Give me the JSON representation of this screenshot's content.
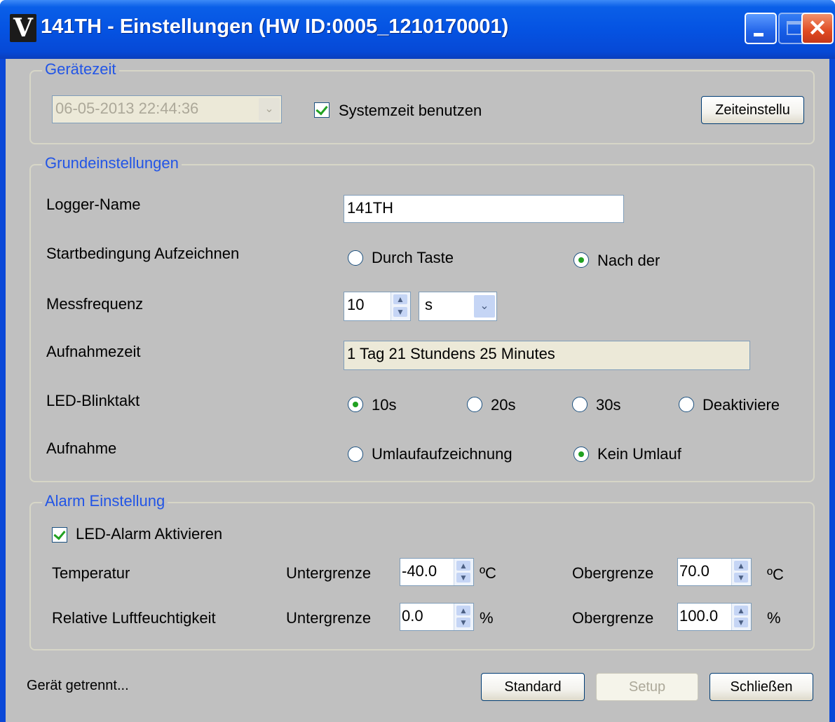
{
  "window": {
    "title": "141TH - Einstellungen (HW ID:0005_1210170001)",
    "icon_letter": "V",
    "close_glyph": "✕"
  },
  "geraetezeit": {
    "legend": "Gerätezeit",
    "datetime_value": "06-05-2013 22:44:36",
    "systemzeit_label": "Systemzeit benutzen",
    "systemzeit_checked": true,
    "zeiteinstellung_button": "Zeiteinstellu"
  },
  "grundeinstellungen": {
    "legend": "Grundeinstellungen",
    "logger_name_label": "Logger-Name",
    "logger_name_value": "141TH",
    "startbedingung_label": "Startbedingung Aufzeichnen",
    "start_options": [
      "Durch Taste",
      "Nach der"
    ],
    "start_selected": "Nach der",
    "messfrequenz_label": "Messfrequenz",
    "messfrequenz_value": "10",
    "messfrequenz_unit": "s",
    "aufnahmezeit_label": "Aufnahmezeit",
    "aufnahmezeit_value": "1 Tag 21 Stundens 25 Minutes",
    "led_blinktakt_label": "LED-Blinktakt",
    "led_options": [
      "10s",
      "20s",
      "30s",
      "Deaktiviere"
    ],
    "led_selected": "10s",
    "aufnahme_label": "Aufnahme",
    "aufnahme_options": [
      "Umlaufaufzeichnung",
      "Kein Umlauf"
    ],
    "aufnahme_selected": "Kein Umlauf"
  },
  "alarm": {
    "legend": "Alarm Einstellung",
    "led_alarm_label": "LED-Alarm Aktivieren",
    "led_alarm_checked": true,
    "temp_label": "Temperatur",
    "untergrenze_label": "Untergrenze",
    "obergrenze_label": "Obergrenze",
    "temp_lower": "-40.0",
    "temp_upper": "70.0",
    "temp_unit": "ºC",
    "humidity_label": "Relative Luftfeuchtigkeit",
    "hum_lower": "0.0",
    "hum_upper": "100.0",
    "hum_unit": "%"
  },
  "footer": {
    "status": "Gerät getrennt...",
    "standard_button": "Standard",
    "setup_button": "Setup",
    "schliessen_button": "Schließen"
  },
  "icons": {
    "spin_up": "▲",
    "spin_down": "▼",
    "combo_arrow": "⌄"
  },
  "colors": {
    "titlebar": "#0553e2",
    "legend_text": "#2255e6",
    "dialog_bg": "#c0c0c0",
    "check_green": "#21a121"
  }
}
